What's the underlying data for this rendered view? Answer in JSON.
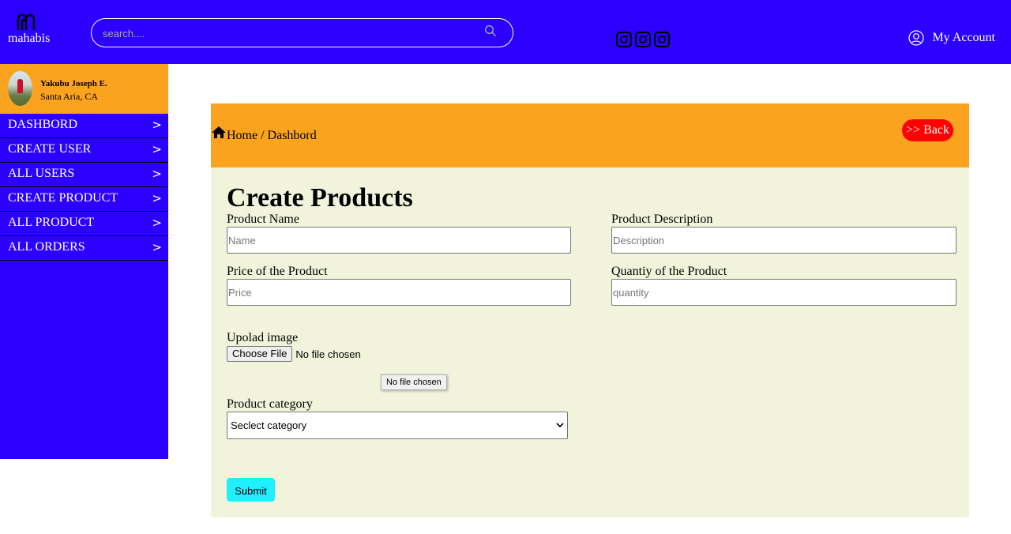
{
  "brand": {
    "name": "mahabis"
  },
  "search": {
    "placeholder": "search...."
  },
  "header": {
    "socials": [
      "instagram-icon",
      "instagram-icon",
      "instagram-icon"
    ],
    "account_label": "My Account"
  },
  "profile": {
    "name": "Yakubu Joseph E.",
    "location": "Santa Aria, CA"
  },
  "sidebar": {
    "items": [
      {
        "label": "DASHBORD",
        "arrow": ">"
      },
      {
        "label": "CREATE USER",
        "arrow": ">"
      },
      {
        "label": "ALL USERS",
        "arrow": ">"
      },
      {
        "label": "CREATE PRODUCT",
        "arrow": ">"
      },
      {
        "label": "ALL PRODUCT",
        "arrow": ">"
      },
      {
        "label": "ALL ORDERS",
        "arrow": ">"
      }
    ]
  },
  "breadcrumb": {
    "text": "Home / Dashbord"
  },
  "back_button": {
    "label": ">> Back"
  },
  "form": {
    "title": "Create Products",
    "product_name": {
      "label": "Product Name",
      "placeholder": "Name"
    },
    "product_description": {
      "label": "Product Description",
      "placeholder": "Description"
    },
    "price": {
      "label": "Price of the Product",
      "placeholder": "Price"
    },
    "quantity": {
      "label": "Quantiy of the Product",
      "placeholder": "quantity"
    },
    "image": {
      "label": "Upolad image",
      "button": "Choose File",
      "status": "No file chosen",
      "tooltip": "No file chosen"
    },
    "category": {
      "label": "Product category",
      "selected": "Seclect category"
    },
    "submit_label": "Submit"
  },
  "colors": {
    "header_bg": "#2c00ff",
    "accent_orange": "#fba21f",
    "form_bg": "#f1f3db",
    "back_red": "#ff0000",
    "submit_cyan": "#1ff0ff"
  }
}
